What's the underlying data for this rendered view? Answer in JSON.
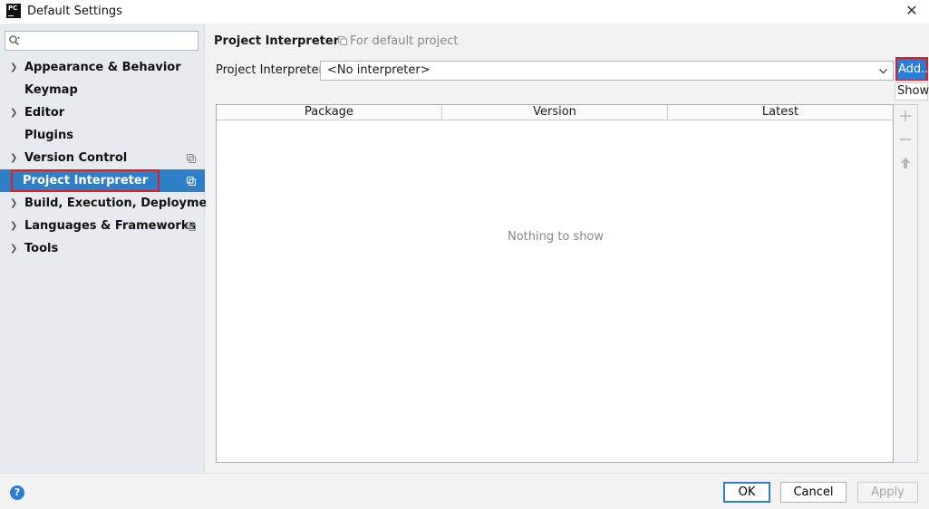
{
  "window": {
    "logo_text": "PC",
    "title": "Default Settings",
    "close_glyph": "✕"
  },
  "sidebar": {
    "search": {
      "value": "",
      "placeholder": ""
    },
    "items": [
      {
        "label": "Appearance & Behavior",
        "expandable": true,
        "has_project_icon": false,
        "selected": false
      },
      {
        "label": "Keymap",
        "expandable": false,
        "has_project_icon": false,
        "selected": false
      },
      {
        "label": "Editor",
        "expandable": true,
        "has_project_icon": false,
        "selected": false
      },
      {
        "label": "Plugins",
        "expandable": false,
        "has_project_icon": false,
        "selected": false
      },
      {
        "label": "Version Control",
        "expandable": true,
        "has_project_icon": true,
        "selected": false
      },
      {
        "label": "Project Interpreter",
        "expandable": false,
        "has_project_icon": true,
        "selected": true
      },
      {
        "label": "Build, Execution, Deployment",
        "expandable": true,
        "has_project_icon": false,
        "selected": false
      },
      {
        "label": "Languages & Frameworks",
        "expandable": true,
        "has_project_icon": true,
        "selected": false
      },
      {
        "label": "Tools",
        "expandable": true,
        "has_project_icon": false,
        "selected": false
      }
    ]
  },
  "main": {
    "title": "Project Interpreter",
    "scope_label": "For default project",
    "interpreter_label": "Project Interpreter:",
    "interpreter_value": "<No interpreter>",
    "add_button": "Add...",
    "show_tooltip": "Show",
    "table": {
      "columns": [
        "Package",
        "Version",
        "Latest"
      ],
      "empty_text": "Nothing to show"
    }
  },
  "footer": {
    "help_glyph": "?",
    "ok": "OK",
    "cancel": "Cancel",
    "apply": "Apply"
  },
  "colors": {
    "accent": "#2f7ec8",
    "highlight_box": "#e02020",
    "sidebar_bg": "#e7ebf0"
  }
}
